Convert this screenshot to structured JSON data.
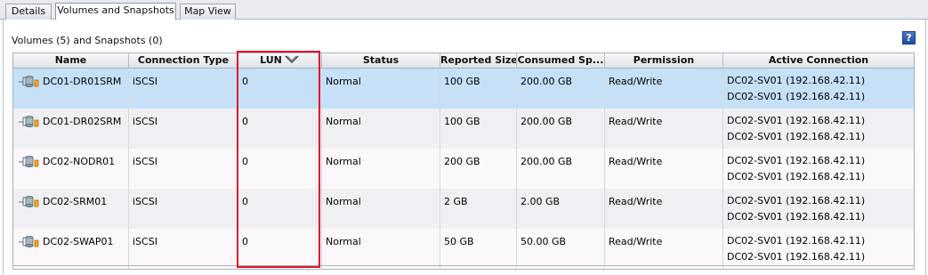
{
  "tabs": [
    {
      "label": "Details"
    },
    {
      "label": "Volumes and Snapshots"
    },
    {
      "label": "Map View"
    }
  ],
  "caption": "Volumes (5) and Snapshots (0)",
  "help_label": "?",
  "columns": [
    "Name",
    "Connection Type",
    "LUN",
    "Status",
    "Reported Size",
    "Consumed Sp...",
    "Permission",
    "Active Connection"
  ],
  "rows": [
    {
      "name": "DC01-DR01SRM",
      "conn": "iSCSI",
      "lun": "0",
      "status": "Normal",
      "size": "100 GB",
      "consumed": "200.00 GB",
      "perm": "Read/Write",
      "active1": "DC02-SV01 (192.168.42.11)",
      "active2": "DC02-SV01 (192.168.42.11)"
    },
    {
      "name": "DC01-DR02SRM",
      "conn": "iSCSI",
      "lun": "0",
      "status": "Normal",
      "size": "100 GB",
      "consumed": "200.00 GB",
      "perm": "Read/Write",
      "active1": "DC02-SV01 (192.168.42.11)",
      "active2": "DC02-SV01 (192.168.42.11)"
    },
    {
      "name": "DC02-NODR01",
      "conn": "iSCSI",
      "lun": "0",
      "status": "Normal",
      "size": "200 GB",
      "consumed": "200.00 GB",
      "perm": "Read/Write",
      "active1": "DC02-SV01 (192.168.42.11)",
      "active2": "DC02-SV01 (192.168.42.11)"
    },
    {
      "name": "DC02-SRM01",
      "conn": "iSCSI",
      "lun": "0",
      "status": "Normal",
      "size": "2 GB",
      "consumed": "2.00 GB",
      "perm": "Read/Write",
      "active1": "DC02-SV01 (192.168.42.11)",
      "active2": "DC02-SV01 (192.168.42.11)"
    },
    {
      "name": "DC02-SWAP01",
      "conn": "iSCSI",
      "lun": "0",
      "status": "Normal",
      "size": "50 GB",
      "consumed": "50.00 GB",
      "perm": "Read/Write",
      "active1": "DC02-SV01 (192.168.42.11)",
      "active2": "DC02-SV01 (192.168.42.11)"
    }
  ],
  "selected_row": 0,
  "sorted_column": "LUN",
  "colors": {
    "selection": "#c5e0f7",
    "highlight_box": "#e0142a",
    "help_button": "#2a5caf"
  },
  "icons": {
    "volume": "volume-disk-icon",
    "sort": "sort-descending-chevron-icon",
    "help": "help-icon"
  }
}
